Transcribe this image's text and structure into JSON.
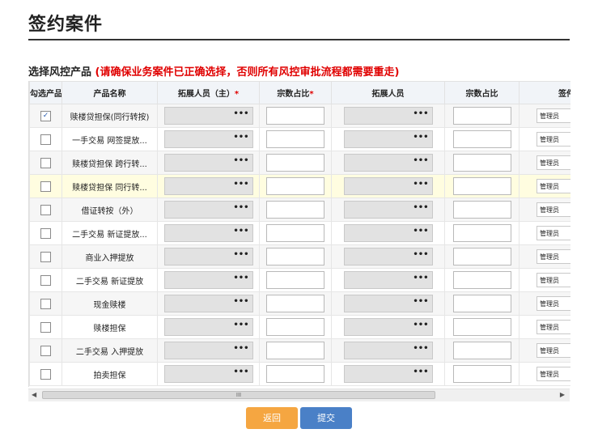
{
  "page": {
    "title": "签约案件",
    "section_label": "选择风控产品",
    "warning": "(请确保业务案件已正确选择，否则所有风控审批流程都需要重走)"
  },
  "table": {
    "headers": {
      "select": "勾选产品",
      "product": "产品名称",
      "staff_main": "拓展人员（主）",
      "share_main": "宗数占比",
      "staff": "拓展人员",
      "share": "宗数占比",
      "sign": "签件"
    },
    "required_mark": "*",
    "picker_icon": "•••",
    "sign_default": "管理员",
    "rows": [
      {
        "product": "赎楼贷担保(同行转按)",
        "checked": true
      },
      {
        "product": "一手交易 网签提放...",
        "checked": false
      },
      {
        "product": "赎楼贷担保 跨行转...",
        "checked": false
      },
      {
        "product": "赎楼贷担保 同行转...",
        "checked": false
      },
      {
        "product": "借证转按（外）",
        "checked": false
      },
      {
        "product": "二手交易 新证提放...",
        "checked": false
      },
      {
        "product": "商业入押提放",
        "checked": false
      },
      {
        "product": "二手交易 新证提放",
        "checked": false
      },
      {
        "product": "现金赎楼",
        "checked": false
      },
      {
        "product": "赎楼担保",
        "checked": false
      },
      {
        "product": "二手交易 入押提放",
        "checked": false
      },
      {
        "product": "拍卖担保",
        "checked": false
      }
    ]
  },
  "scrollbar": {
    "left_arrow": "◀",
    "right_arrow": "▶",
    "grip": "III"
  },
  "buttons": {
    "back": "返回",
    "submit": "提交"
  },
  "colors": {
    "warning": "#e00000",
    "back_button": "#f5a641",
    "submit_button": "#4a80c7",
    "highlight_row": "#fffde0"
  }
}
